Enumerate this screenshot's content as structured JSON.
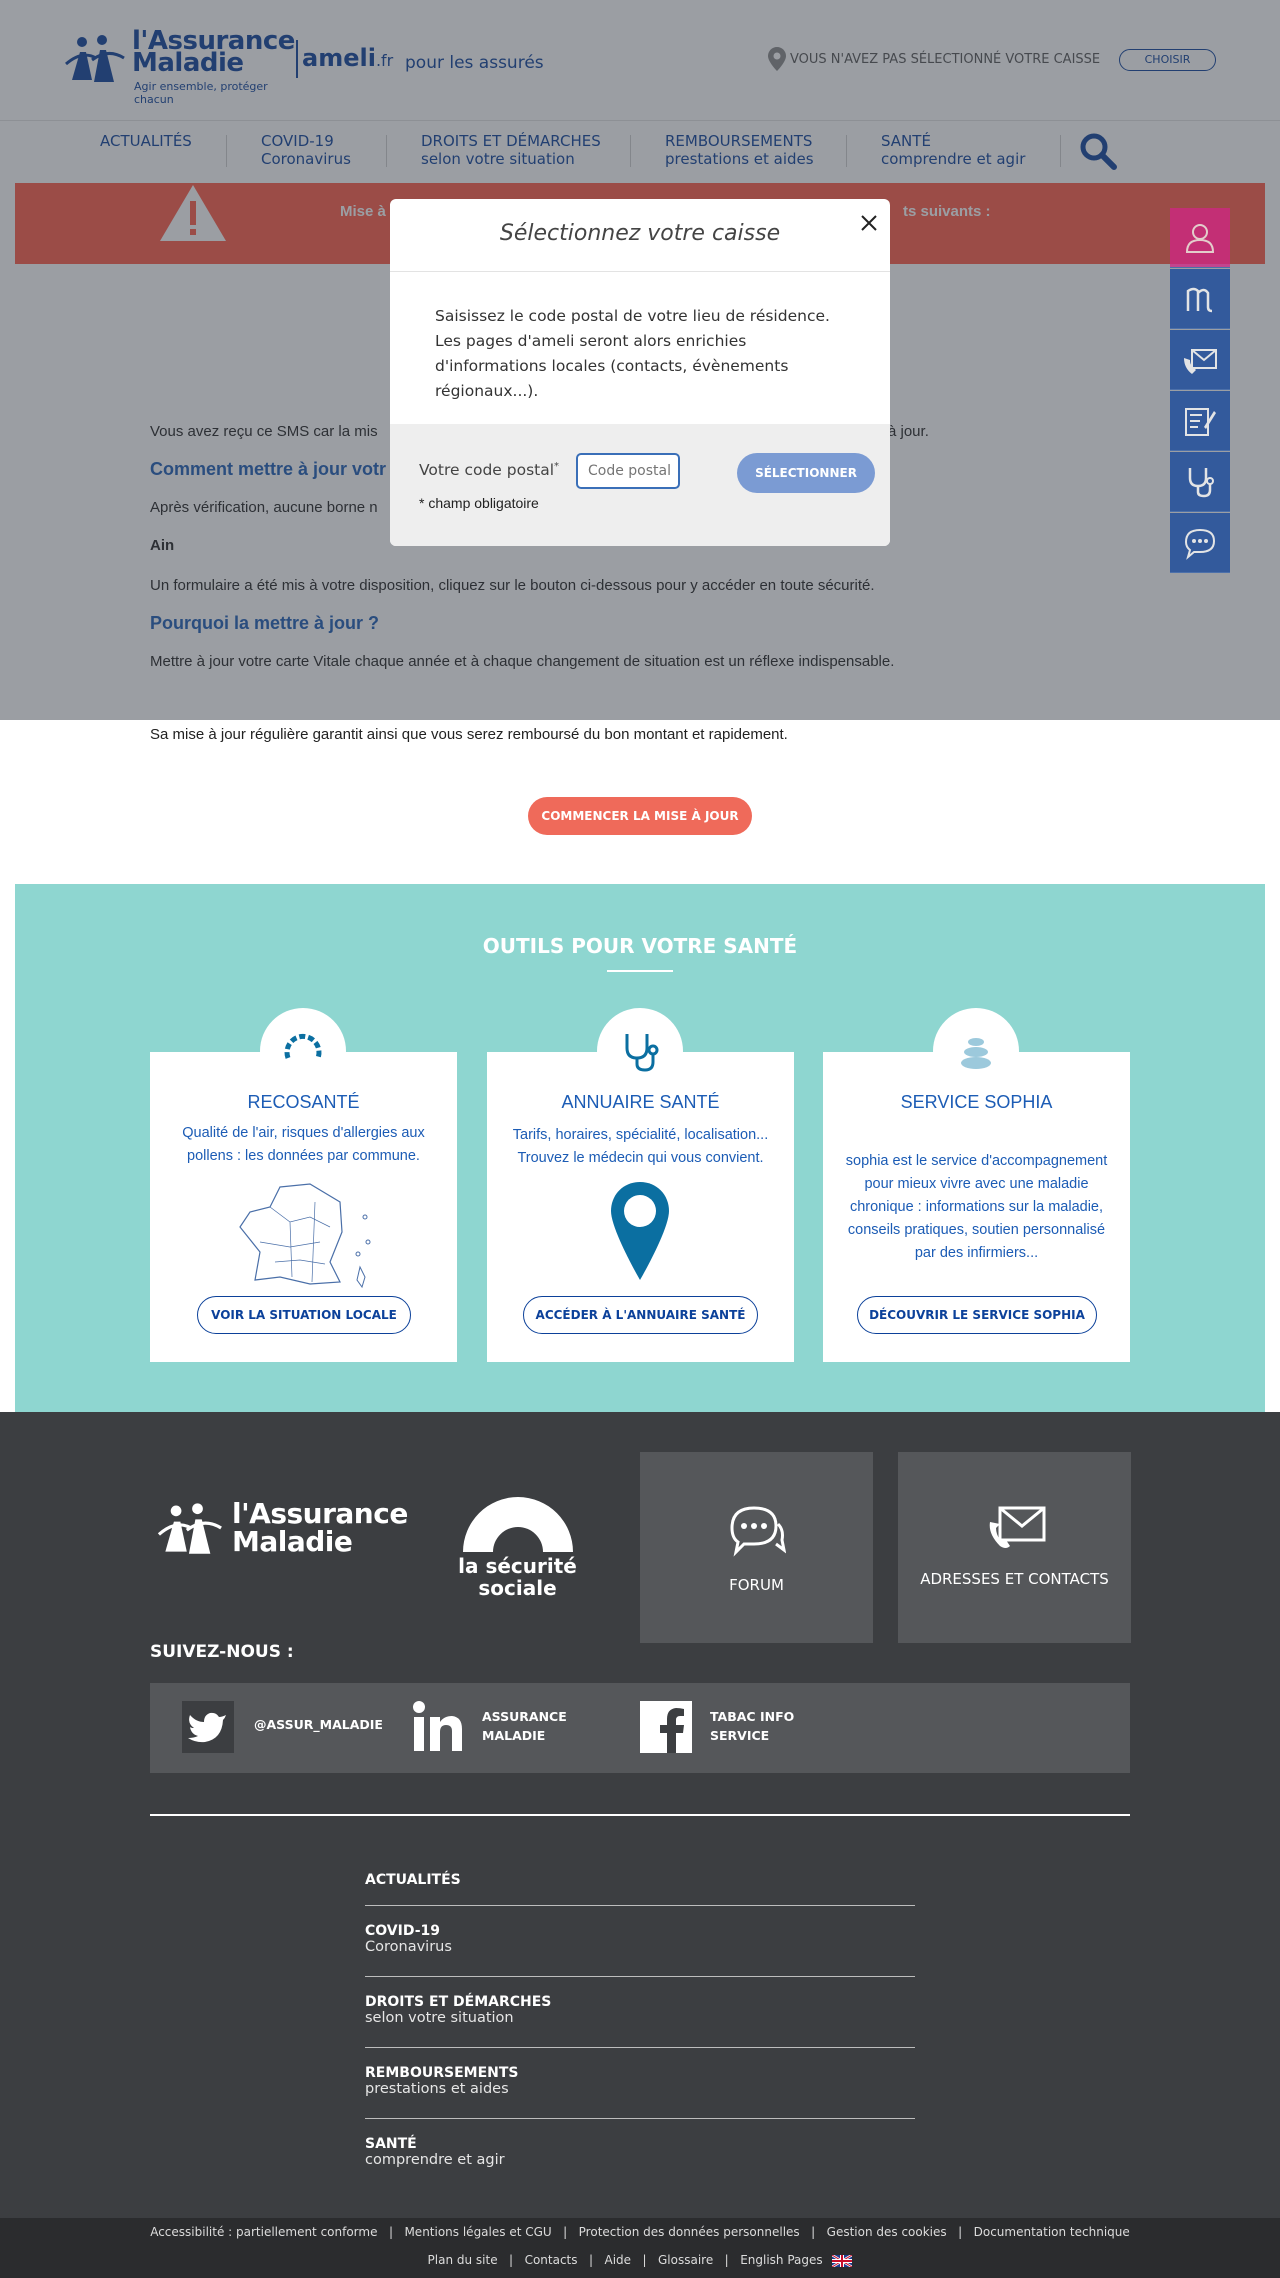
{
  "header": {
    "logo_title_line1": "l'Assurance",
    "logo_title_line2": "Maladie",
    "logo_tagline": "Agir ensemble, protéger chacun",
    "ameli": "ameli",
    "ameli_tld": ".fr",
    "subtitle": "pour les assurés",
    "caisse_text": "VOUS N'AVEZ PAS SÉLECTIONNÉ VOTRE CAISSE",
    "choose_label": "CHOISIR"
  },
  "nav": {
    "items": [
      {
        "title": "ACTUALITÉS",
        "sub": ""
      },
      {
        "title": "COVID-19",
        "sub": "Coronavirus"
      },
      {
        "title": "DROITS ET DÉMARCHES",
        "sub": "selon votre situation"
      },
      {
        "title": "REMBOURSEMENTS",
        "sub": "prestations et aides"
      },
      {
        "title": "SANTÉ",
        "sub": "comprendre et agir"
      }
    ]
  },
  "alert": {
    "text_left": "Mise à",
    "text_right": "ts suivants :"
  },
  "content": {
    "p1_left": "Vous avez reçu ce SMS car la mis",
    "p1_right": "à jour.",
    "h1": "Comment mettre à jour votr",
    "p2": "Après vérification, aucune borne n",
    "p3": "Ain",
    "p4": "Un formulaire a été mis à votre disposition, cliquez sur le bouton ci-dessous pour y accéder en toute sécurité.",
    "h2": "Pourquoi la mettre à jour ?",
    "p5": "Mettre à jour votre carte Vitale chaque année et à chaque changement de situation est un réflexe indispensable.",
    "p6": "Sa mise à jour régulière garantit ainsi que vous serez remboursé du bon montant et rapidement.",
    "cta": "COMMENCER LA MISE À JOUR"
  },
  "outils": {
    "title": "OUTILS POUR VOTRE SANTÉ",
    "cards": [
      {
        "title": "RECOSANTÉ",
        "desc": "Qualité de l'air, risques d'allergies aux pollens : les données par commune.",
        "button": "VOIR LA SITUATION LOCALE"
      },
      {
        "title": "ANNUAIRE SANTÉ",
        "desc": "Tarifs, horaires, spécialité, localisation... Trouvez le médecin qui vous convient.",
        "button": "ACCÉDER À L'ANNUAIRE SANTÉ"
      },
      {
        "title": "SERVICE SOPHIA",
        "desc": "sophia est le service d'accompagnement pour mieux vivre avec une maladie chronique : informations sur la maladie, conseils pratiques, soutien personnalisé par des infirmiers...",
        "button": "DÉCOUVRIR LE SERVICE SOPHIA"
      }
    ]
  },
  "footer": {
    "logo_line1": "l'Assurance",
    "logo_line2": "Maladie",
    "secu_line1": "la sécurité",
    "secu_line2": "sociale",
    "forum": "FORUM",
    "contacts": "ADRESSES ET CONTACTS",
    "suivez": "SUIVEZ-NOUS :",
    "social": [
      {
        "line1": "@ASSUR_MALADIE",
        "line2": ""
      },
      {
        "line1": "ASSURANCE",
        "line2": "MALADIE"
      },
      {
        "line1": "TABAC INFO",
        "line2": "SERVICE"
      }
    ],
    "nav": [
      {
        "title": "ACTUALITÉS",
        "sub": ""
      },
      {
        "title": "COVID-19",
        "sub": "Coronavirus"
      },
      {
        "title": "DROITS ET DÉMARCHES",
        "sub": "selon votre situation"
      },
      {
        "title": "REMBOURSEMENTS",
        "sub": "prestations et aides"
      },
      {
        "title": "SANTÉ",
        "sub": "comprendre et agir"
      }
    ]
  },
  "bottom_links": {
    "row1": [
      "Accessibilité : partiellement conforme",
      "Mentions légales et CGU",
      "Protection des données personnelles",
      "Gestion des cookies",
      "Documentation technique"
    ],
    "row2": [
      "Plan du site",
      "Contacts",
      "Aide",
      "Glossaire",
      "English Pages"
    ]
  },
  "modal": {
    "title": "Sélectionnez votre caisse",
    "body": "Saisissez le code postal de votre lieu de résidence. Les pages d'ameli seront alors enrichies d'informations locales (contacts, évènements régionaux...).",
    "label": "Votre code postal",
    "label_star": "*",
    "placeholder": "Code postal",
    "submit": "SÉLECTIONNER",
    "required_note": "* champ obligatoire"
  },
  "colors": {
    "brand_blue": "#0c419a",
    "alert_red": "#ff5a46",
    "teal": "#8ed6d0",
    "cta_red": "#ef6a5a",
    "footer_dark": "#3c3e41",
    "sidebar_pink": "#d32487"
  },
  "icons": [
    "location-pin-icon",
    "search-icon",
    "warning-icon",
    "user-icon",
    "ameli-m-icon",
    "phone-mail-icon",
    "form-edit-icon",
    "stethoscope-icon",
    "chat-icon",
    "close-icon",
    "gauge-icon",
    "map-pin-icon",
    "stones-icon",
    "twitter-icon",
    "linkedin-icon",
    "facebook-icon",
    "uk-flag-icon"
  ]
}
